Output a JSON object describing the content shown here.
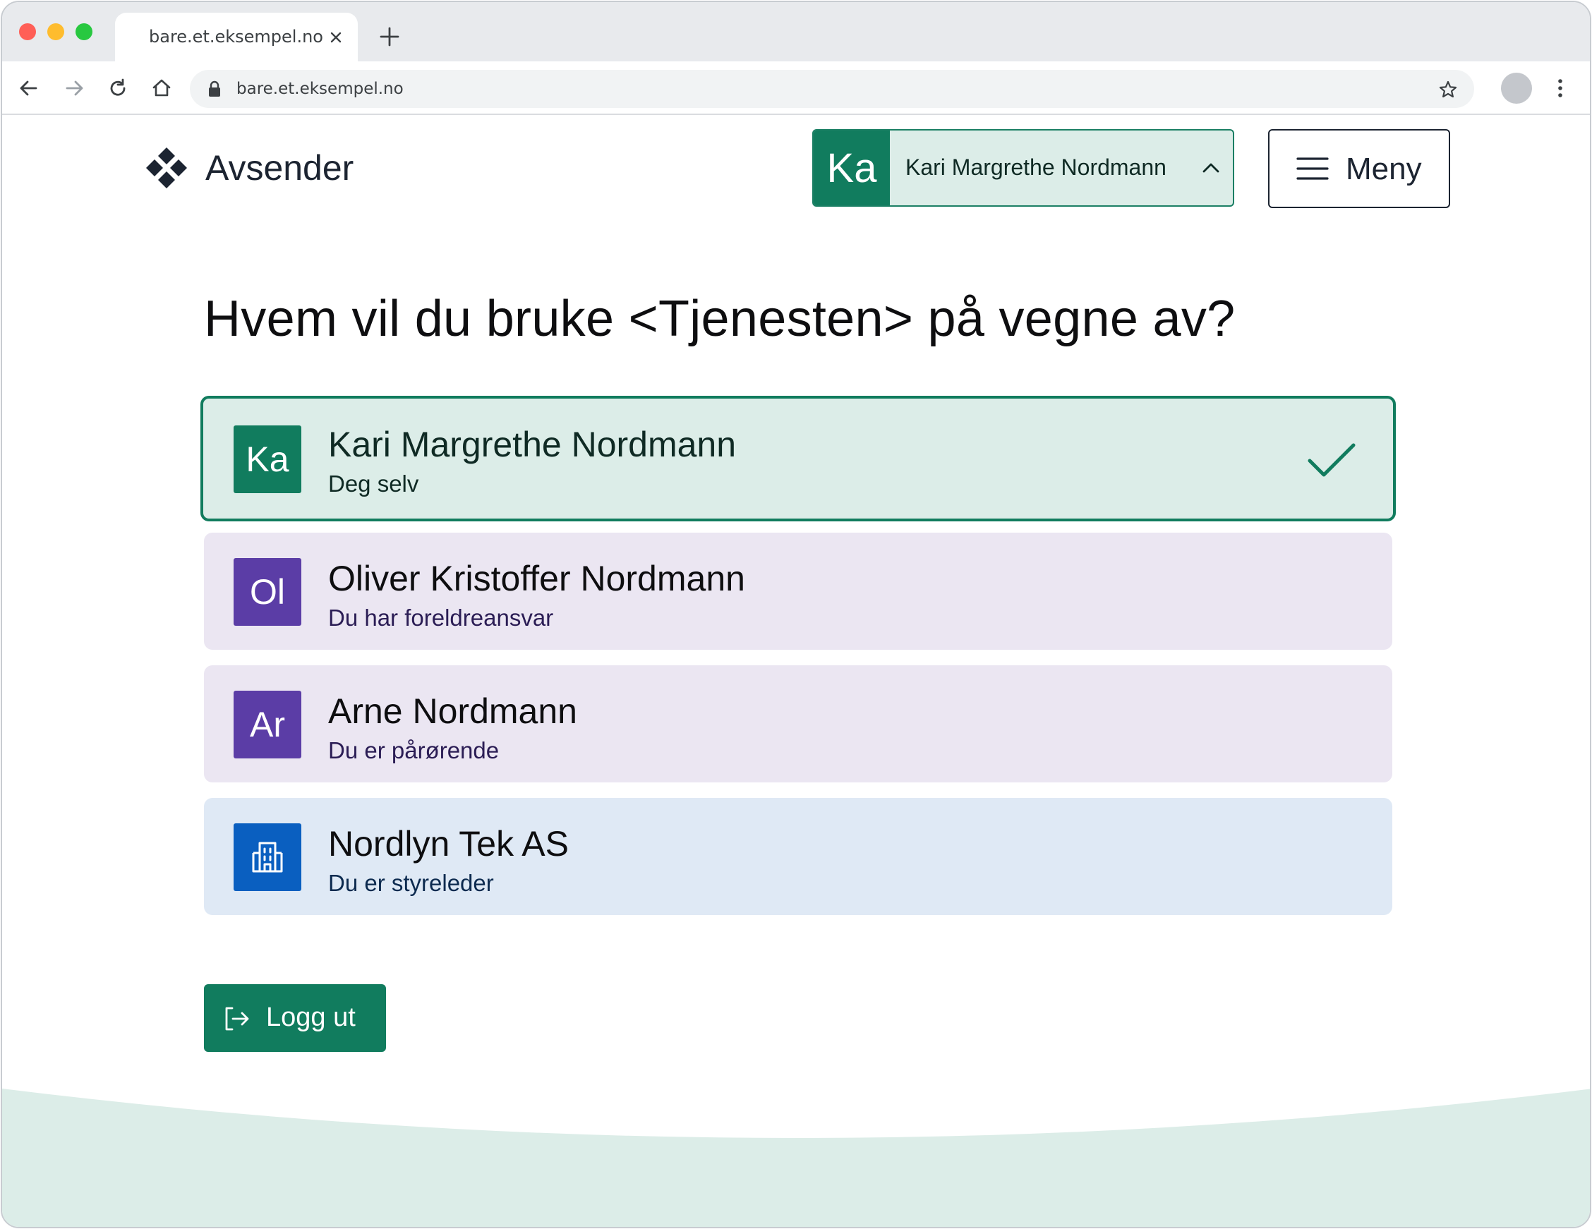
{
  "browser": {
    "tab_title": "bare.et.eksempel.no",
    "url": "bare.et.eksempel.no"
  },
  "header": {
    "brand": "Avsender",
    "account": {
      "initials": "Ka",
      "name": "Kari Margrethe Nordmann"
    },
    "menu_label": "Meny"
  },
  "main": {
    "heading": "Hvem vil du bruke <Tjenesten> på vegne av?",
    "options": [
      {
        "initials": "Ka",
        "name": "Kari Margrethe Nordmann",
        "description": "Deg selv",
        "selected": true,
        "color": "#117c5e"
      },
      {
        "initials": "Ol",
        "name": "Oliver Kristoffer Nordmann",
        "description": "Du har foreldreansvar",
        "selected": false,
        "color": "#5b3da6"
      },
      {
        "initials": "Ar",
        "name": "Arne Nordmann",
        "description": "Du er pårørende",
        "selected": false,
        "color": "#5b3da6"
      },
      {
        "icon": "building-icon",
        "name": "Nordlyn Tek AS",
        "description": "Du er styreleder",
        "selected": false,
        "color": "#0a5fc0"
      }
    ],
    "logout_label": "Logg ut"
  },
  "colors": {
    "accent": "#117c5e",
    "accent_light": "#dcede8",
    "person_bg": "#ebe6f2",
    "company_bg": "#dfe9f5"
  }
}
